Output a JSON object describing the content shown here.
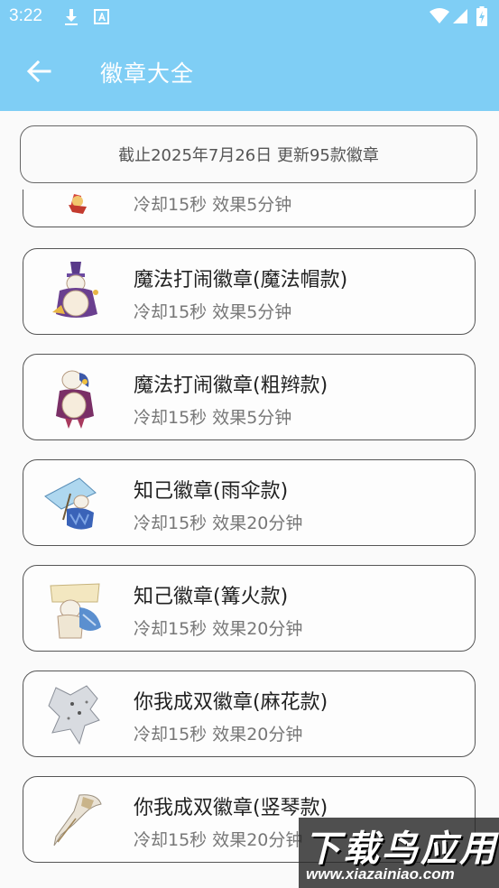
{
  "status_bar": {
    "time": "3:22"
  },
  "app_bar": {
    "title": "徽章大全"
  },
  "notice": {
    "text": "截止2025年7月26日 更新95款徽章"
  },
  "badges": [
    {
      "name": "",
      "desc": "冷却15秒 效果5分钟"
    },
    {
      "name": "魔法打闹徽章(魔法帽款)",
      "desc": "冷却15秒 效果5分钟"
    },
    {
      "name": "魔法打闹徽章(粗辫款)",
      "desc": "冷却15秒 效果5分钟"
    },
    {
      "name": "知己徽章(雨伞款)",
      "desc": "冷却15秒 效果20分钟"
    },
    {
      "name": "知己徽章(篝火款)",
      "desc": "冷却15秒 效果20分钟"
    },
    {
      "name": "你我成双徽章(麻花款)",
      "desc": "冷却15秒 效果20分钟"
    },
    {
      "name": "你我成双徽章(竖琴款)",
      "desc": "冷却15秒 效果20分钟"
    }
  ],
  "watermark": {
    "title": "下载鸟应用",
    "url": "www.xiazainiao.com"
  },
  "colors": {
    "app_bar": "#7fcef5",
    "card_border": "#555555",
    "title_text": "#222222",
    "desc_text": "#777777"
  },
  "icons": [
    "download-icon",
    "font-app-icon",
    "wifi-icon",
    "signal-icon",
    "battery-icon",
    "back-arrow-icon"
  ]
}
